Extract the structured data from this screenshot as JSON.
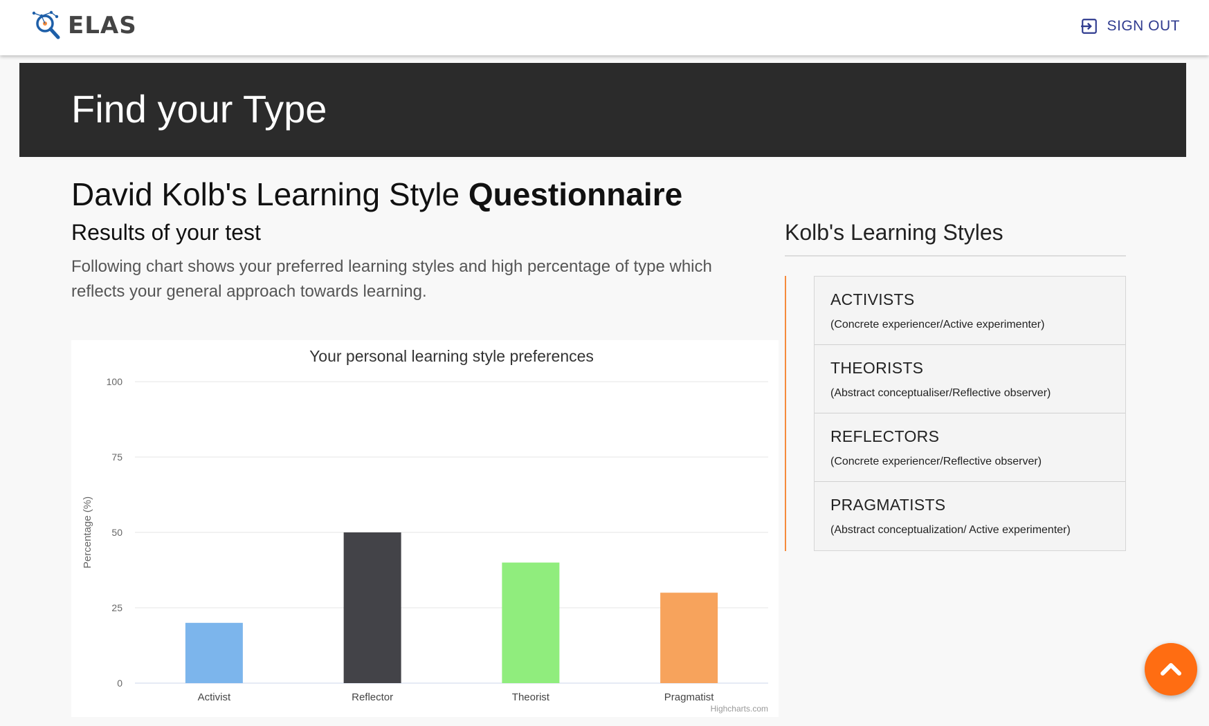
{
  "header": {
    "logo_text": "ELAS",
    "signout_label": "SIGN OUT"
  },
  "banner": {
    "title": "Find your Type"
  },
  "main": {
    "title_regular": "David Kolb's Learning Style ",
    "title_bold": "Questionnaire",
    "subtitle": "Results of your test",
    "description": "Following chart shows your preferred learning styles and high percentage of type which reflects your general approach towards learning."
  },
  "sidebar": {
    "title": "Kolb's Learning Styles",
    "items": [
      {
        "name": "ACTIVISTS",
        "desc": "(Concrete experiencer/Active experimenter)"
      },
      {
        "name": "THEORISTS",
        "desc": "(Abstract conceptualiser/Reflective observer)"
      },
      {
        "name": "REFLECTORS",
        "desc": "(Concrete experiencer/Reflective observer)"
      },
      {
        "name": "PRAGMATISTS",
        "desc": "(Abstract conceptualization/ Active experimenter)"
      }
    ]
  },
  "chart_data": {
    "type": "bar",
    "title": "Your personal learning style preferences",
    "xlabel": "",
    "ylabel": "Percentage (%)",
    "ylim": [
      0,
      100
    ],
    "yticks": [
      0,
      25,
      50,
      75,
      100
    ],
    "categories": [
      "Activist",
      "Reflector",
      "Theorist",
      "Pragmatist"
    ],
    "values": [
      20,
      50,
      40,
      30
    ],
    "colors": [
      "#7cb5ec",
      "#434348",
      "#90ed7d",
      "#f7a35c"
    ],
    "grid": true,
    "legend": "none",
    "credit": "Highcharts.com"
  },
  "colors": {
    "banner_bg": "#2b2b2b",
    "accent_orange": "#ff6d12",
    "signout_blue": "#2f3b8f"
  },
  "icons": {
    "logo": "magnifier-network-icon",
    "signout": "exit-icon",
    "fab": "chevron-up-icon"
  }
}
